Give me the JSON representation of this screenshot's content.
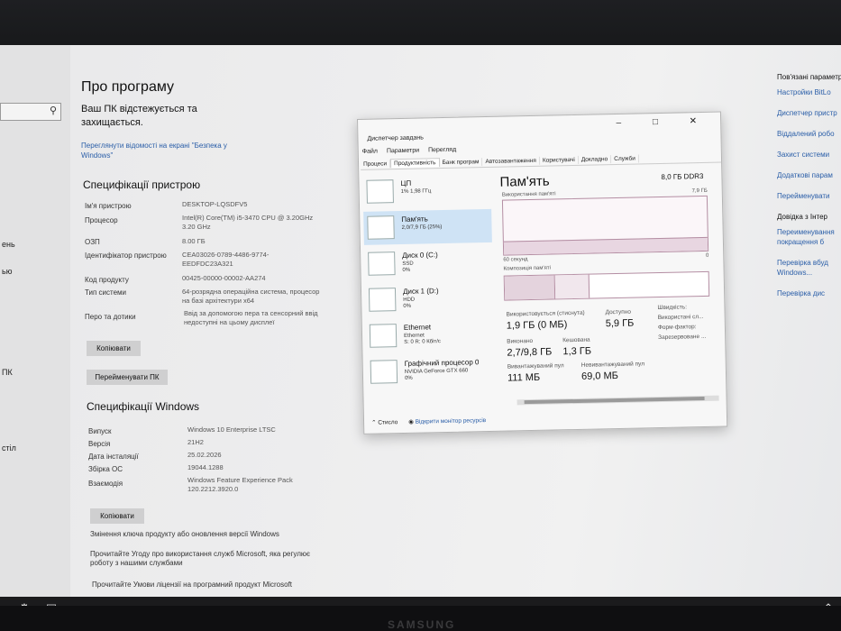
{
  "settings": {
    "page_title": "Про програму",
    "protection_text": "Ваш ПК відстежується та захищається.",
    "security_link": "Переглянути відомості на екрані \"Безпека у Windows\"",
    "device_specs_title": "Специфікації пристрою",
    "device_specs": [
      {
        "label": "Ім'я пристрою",
        "value": "DESKTOP-LQSDFV5"
      },
      {
        "label": "Процесор",
        "value": "Intel(R) Core(TM) i5-3470 CPU @ 3.20GHz 3.20 GHz"
      },
      {
        "label": "ОЗП",
        "value": "8.00 ГБ"
      },
      {
        "label": "Ідентифікатор пристрою",
        "value": "CEA03026-0789-4486-9774-EEDFDC23A321"
      },
      {
        "label": "Код продукту",
        "value": "00425-00000-00002-AA274"
      },
      {
        "label": "Тип системи",
        "value": "64-розрядна операційна система, процесор на базі архітектури x64"
      },
      {
        "label": "Перо та дотики",
        "value": "Ввід за допомогою пера та сенсорний ввід недоступні на цьому дисплеї"
      }
    ],
    "copy_button": "Копіювати",
    "rename_button": "Перейменувати ПК",
    "windows_specs_title": "Специфікації Windows",
    "windows_specs": [
      {
        "label": "Випуск",
        "value": "Windows 10 Enterprise LTSC"
      },
      {
        "label": "Версія",
        "value": "21H2"
      },
      {
        "label": "Дата інсталяції",
        "value": "25.02.2026"
      },
      {
        "label": "Збірка ОС",
        "value": "19044.1288"
      },
      {
        "label": "Взаємодія",
        "value": "Windows Feature Experience Pack 120.2212.3920.0"
      }
    ],
    "copy_button_2": "Копіювати",
    "links": [
      "Змінення ключа продукту або оновлення версії Windows",
      "Прочитайте Угоду про використання служб Microsoft, яка регулює роботу з нашими службами",
      "Прочитайте Умови ліцензії на програмний продукт Microsoft"
    ]
  },
  "left_labels": [
    "ень",
    "ью",
    "ПК",
    "стіл"
  ],
  "right_col": {
    "header": "Пов'язані параметри",
    "items": [
      "Настройки BitLo",
      "Диспетчер пристр",
      "Віддалений робо",
      "Захист системи",
      "Додаткові парам",
      "Перейменувати"
    ],
    "header2": "Довідка з Інтер",
    "items2": [
      "Переименування покращення б",
      "Перевірка вбуд Windows...",
      "Перевірка дис"
    ]
  },
  "task_manager": {
    "title": "Диспетчер завдань",
    "controls": "–  □  ✕",
    "menu": [
      "Файл",
      "Параметри",
      "Перегляд"
    ],
    "tabs": [
      "Процеси",
      "Продуктивність",
      "Банк програм",
      "Автозавантаження",
      "Користувачі",
      "Докладно",
      "Служби"
    ],
    "items": [
      {
        "name": "ЦП",
        "sub": "1% 1,98 ГГц"
      },
      {
        "name": "Пам'ять",
        "sub": "2,0/7,9 ГБ (25%)"
      },
      {
        "name": "Диск 0 (C:)",
        "sub": "SSD\n0%"
      },
      {
        "name": "Диск 1 (D:)",
        "sub": "HDD\n0%"
      },
      {
        "name": "Ethernet",
        "sub": "Ethernet\nS: 0 R: 0 Кбіт/с"
      },
      {
        "name": "Графічний процесор 0",
        "sub": "NVIDIA GeForce GTX 660\n0%"
      }
    ],
    "pane_title": "Пам'ять",
    "total": "8,0 ГБ DDR3",
    "usage_label": "Використання пам'яті",
    "usage_max": "7,9 ГБ",
    "seconds": "60 секунд",
    "zero": "0",
    "composition_label": "Композиція пам'яті",
    "usage_fraction": 0.25,
    "stats": [
      {
        "label": "Використовується (стиснута)",
        "value": "1,9 ГБ (0 МБ)"
      },
      {
        "label": "Доступно",
        "value": "5,9 ГБ"
      },
      {
        "label": "Виконано",
        "value": "2,7/9,8 ГБ"
      },
      {
        "label": "Кешована",
        "value": "1,3 ГБ"
      },
      {
        "label": "Вивантажуваний пул",
        "value": "111 МБ"
      },
      {
        "label": "Невивантажуваний пул",
        "value": "69,0 МБ"
      }
    ],
    "side_labels": [
      "Швидкість:",
      "Використані сл...",
      "Форм-фактор:",
      "Зарезервоване ..."
    ],
    "footer_less": "Стисло",
    "footer_link": "Відкрити монітор ресурсів"
  },
  "brand": "SAMSUNG"
}
